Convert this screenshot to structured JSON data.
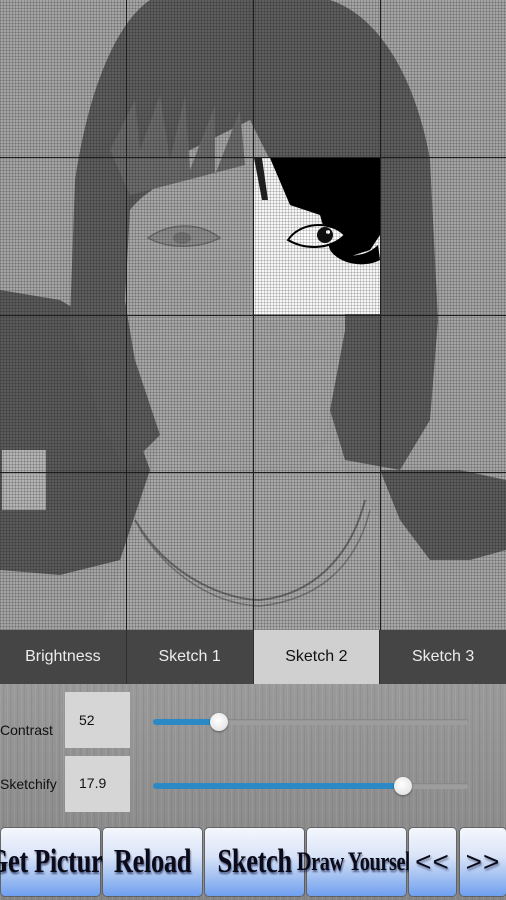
{
  "canvas": {
    "description": "sketch-filtered portrait with 4x4 grid overlay; one cell shown at full contrast",
    "grid": {
      "columns": 4,
      "rows": 4,
      "highlighted_cell": {
        "column": 3,
        "row": 2
      }
    }
  },
  "tabs": [
    {
      "label": "Brightness",
      "active": false
    },
    {
      "label": "Sketch 1",
      "active": false
    },
    {
      "label": "Sketch 2",
      "active": true
    },
    {
      "label": "Sketch 3",
      "active": false
    }
  ],
  "controls": {
    "contrast": {
      "label": "Contrast",
      "value": "52",
      "slider_fraction": 0.21
    },
    "sketchify": {
      "label": "Sketchify",
      "value": "17.9",
      "slider_fraction": 0.79
    }
  },
  "colors": {
    "tab_bar": "#454545",
    "tab_active": "#d0d0d0",
    "slider_fill": "#2b8ac6",
    "button_gradient_bottom": "#6f9ff0"
  },
  "buttons": [
    {
      "id": "get-picture",
      "label": "Get Picture"
    },
    {
      "id": "reload",
      "label": "Reload"
    },
    {
      "id": "sketch",
      "label": "Sketch"
    },
    {
      "id": "draw-yourself",
      "label": "Draw Yourself"
    },
    {
      "id": "previous",
      "label": "<<"
    },
    {
      "id": "next",
      "label": ">>"
    }
  ]
}
